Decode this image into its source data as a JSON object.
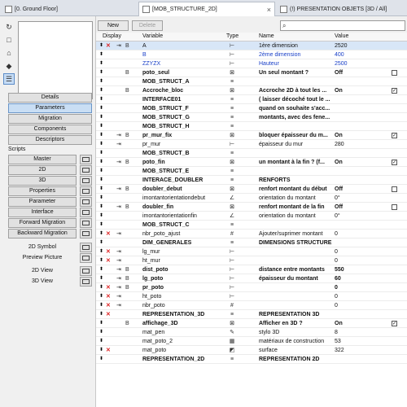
{
  "tabs": [
    {
      "label": "[0. Ground Floor]",
      "icon": "floor-plan-icon"
    },
    {
      "label": "[MOB_STRUCTURE_2D]",
      "icon": "object-icon"
    },
    {
      "label": "(!) PRESENTATION OBJETS [3D / All]",
      "icon": "3d-view-icon"
    }
  ],
  "toolbar": {
    "new_label": "New",
    "delete_label": "Delete",
    "search_value": ""
  },
  "headers": {
    "display": "Display",
    "variable": "Variable",
    "type": "Type",
    "name": "Name",
    "value": "Value"
  },
  "sections": {
    "scripts": "Scripts"
  },
  "left_buttons": [
    "Details",
    "Parameters",
    "Migration",
    "Components",
    "Descriptors"
  ],
  "scripts": [
    "Master",
    "2D",
    "3D",
    "Properties",
    "Parameter",
    "Interface",
    "Forward Migration",
    "Backward Migration"
  ],
  "symbols": [
    "2D Symbol",
    "Preview Picture"
  ],
  "views": [
    "2D View",
    "3D View"
  ],
  "rows": [
    {
      "var": "A",
      "type": "length",
      "name": "1ère dimension",
      "value": "2520",
      "sel": true,
      "x": true,
      "h": true,
      "b": true
    },
    {
      "var": "B",
      "type": "length",
      "name": "2ème dimension",
      "value": "400",
      "blue": true
    },
    {
      "var": "ZZYZX",
      "type": "length",
      "name": "Hauteur",
      "value": "2500",
      "blue": true
    },
    {
      "var": "poto_seul",
      "type": "bool",
      "name": "Un seul montant ?",
      "value": "Off",
      "bold": true,
      "b": true,
      "chk": "off"
    },
    {
      "var": "MOB_STRUCT_A",
      "type": "title",
      "name": "",
      "value": "",
      "bold": true
    },
    {
      "var": "Accroche_bloc",
      "type": "bool",
      "name": "Accroche 2D à tout les ...",
      "value": "On",
      "bold": true,
      "b": true,
      "chk": "on"
    },
    {
      "var": "INTERFACE01",
      "type": "title",
      "name": "( laisser décoché tout le ...",
      "value": "",
      "bold": true
    },
    {
      "var": "MOB_STRUCT_F",
      "type": "title",
      "name": "quand on souhaite s'acc...",
      "value": "",
      "bold": true
    },
    {
      "var": "MOB_STRUCT_G",
      "type": "title",
      "name": "montants, avec des fene...",
      "value": "",
      "bold": true
    },
    {
      "var": "MOB_STRUCT_H",
      "type": "title",
      "name": "",
      "value": "",
      "bold": true
    },
    {
      "var": "pr_mur_fix",
      "type": "bool",
      "name": "bloquer épaisseur du m...",
      "value": "On",
      "bold": true,
      "h": true,
      "b": true,
      "chk": "on"
    },
    {
      "var": "pr_mur",
      "type": "length",
      "name": "épaisseur du mur",
      "value": "280",
      "h": true
    },
    {
      "var": "MOB_STRUCT_B",
      "type": "title",
      "name": "",
      "value": "",
      "bold": true
    },
    {
      "var": "poto_fin",
      "type": "bool",
      "name": "un montant à la fin ? (f...",
      "value": "On",
      "bold": true,
      "h": true,
      "b": true,
      "chk": "on"
    },
    {
      "var": "MOB_STRUCT_E",
      "type": "title",
      "name": "",
      "value": "",
      "bold": true
    },
    {
      "var": "INTERACE_DOUBLER",
      "type": "title",
      "name": "RENFORTS",
      "value": "",
      "bold": true
    },
    {
      "var": "doubler_debut",
      "type": "bool",
      "name": "renfort montant du début",
      "value": "Off",
      "bold": true,
      "h": true,
      "b": true,
      "chk": "off"
    },
    {
      "var": "imontantorientationdebut",
      "type": "angle",
      "name": "orientation du montant",
      "value": "0°"
    },
    {
      "var": "doubler_fin",
      "type": "bool",
      "name": "renfort montant de la fin",
      "value": "Off",
      "bold": true,
      "h": true,
      "b": true,
      "chk": "off"
    },
    {
      "var": "imontantorientationfin",
      "type": "angle",
      "name": "orientation du montant",
      "value": "0°"
    },
    {
      "var": "MOB_STRUCT_C",
      "type": "title",
      "name": "",
      "value": "",
      "bold": true
    },
    {
      "var": "nbr_poto_ajust",
      "type": "int",
      "name": "Ajouter/suprimer montant",
      "value": "0",
      "x": true,
      "h": true
    },
    {
      "var": "DIM_GENERALES",
      "type": "title",
      "name": "DIMENSIONS STRUCTURE",
      "value": "",
      "bold": true
    },
    {
      "var": "lg_mur",
      "type": "length",
      "name": "",
      "value": "0",
      "x": true,
      "h": true
    },
    {
      "var": "ht_mur",
      "type": "length",
      "name": "",
      "value": "0",
      "x": true,
      "h": true
    },
    {
      "var": "dist_poto",
      "type": "length",
      "name": "distance entre montants",
      "value": "550",
      "bold": true,
      "h": true,
      "b": true
    },
    {
      "var": "lg_poto",
      "type": "length",
      "name": "épaisseur du montant",
      "value": "60",
      "bold": true,
      "h": true,
      "b": true
    },
    {
      "var": "pr_poto",
      "type": "length",
      "name": "",
      "value": "0",
      "bold": true,
      "x": true,
      "h": true,
      "b": true
    },
    {
      "var": "ht_poto",
      "type": "length",
      "name": "",
      "value": "0",
      "x": true,
      "h": true
    },
    {
      "var": "nbr_poto",
      "type": "int",
      "name": "",
      "value": "0",
      "x": true,
      "h": true
    },
    {
      "var": "REPRESENTATION_3D",
      "type": "title",
      "name": "REPRESENTATION 3D",
      "value": "",
      "bold": true,
      "x": true
    },
    {
      "var": "affichage_3D",
      "type": "bool",
      "name": "Afficher en 3D ?",
      "value": "On",
      "bold": true,
      "b": true,
      "chk": "on"
    },
    {
      "var": "mat_pen",
      "type": "pen",
      "name": "stylo 3D",
      "value": "8"
    },
    {
      "var": "mat_poto_2",
      "type": "material",
      "name": "matériaux de construction",
      "value": "53"
    },
    {
      "var": "mat_poto",
      "type": "surface",
      "name": "surface",
      "value": "322",
      "x": true
    },
    {
      "var": "REPRESENTATION_2D",
      "type": "title",
      "name": "REPRESENTATION 2D",
      "value": "",
      "bold": true
    }
  ]
}
